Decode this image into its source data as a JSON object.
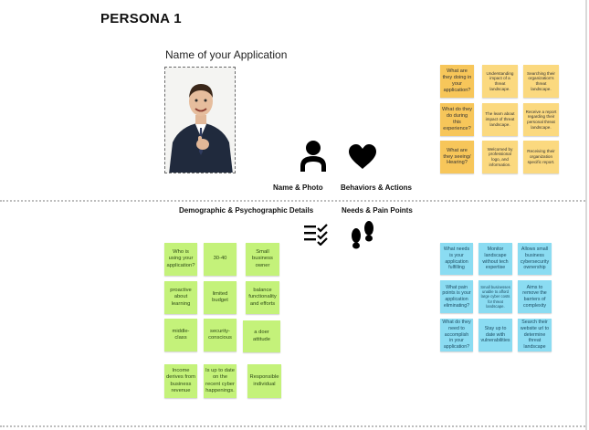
{
  "persona_title": "PERSONA 1",
  "app_name": "Name of your Application",
  "sections": {
    "name_photo": "Name & Photo",
    "behaviors": "Behaviors & Actions",
    "demographic": "Demographic & Psychographic Details",
    "needs": "Needs & Pain Points"
  },
  "icons": {
    "person": "person-icon",
    "heart": "heart-icon",
    "checklist": "checklist-icon",
    "footprints": "footprints-icon"
  },
  "colors": {
    "yellow_question": "#f7c65a",
    "yellow_answer": "#fbd97f",
    "green": "#c4f27a",
    "blue": "#8bdcf2"
  },
  "behavior_notes": [
    [
      "What are they doing in your application?",
      "Understanding impact of a threat landscape.",
      "Searching their organization's threat landscape."
    ],
    [
      "What do they do during this experience?",
      "The learn about impact of threat landscape.",
      "Receive a report regarding their personal threat landscape."
    ],
    [
      "What are they seeing/ Hearing?",
      "Welcomed by professional logo, and information.",
      "Receiving their organization specific report."
    ]
  ],
  "demographic_notes": [
    [
      "Who is using your application?",
      "30-40",
      "Small business owner"
    ],
    [
      "proactive about learning",
      "limited budget",
      "balance functionality and efforts"
    ],
    [
      "middle-class",
      "security-conscious",
      "a doer attitude"
    ],
    [
      "Income derives from business revenue",
      "Is up to date on the recent cyber happenings.",
      "Responsible individual"
    ]
  ],
  "needs_notes": [
    [
      "What needs is your application fulfilling",
      "Monitor landscape without tech expertise",
      "Allows small business cybersecurity ownership"
    ],
    [
      "What pain points is your application eliminating?",
      "Small businesses unable to afford large cyber costs for threat landscape.",
      "Aims to remove the barriers of complexity"
    ],
    [
      "What do they need to accomplish in your application?",
      "Stay up to date with vulnerabilities",
      "Search their website url to determine threat landscape"
    ]
  ]
}
